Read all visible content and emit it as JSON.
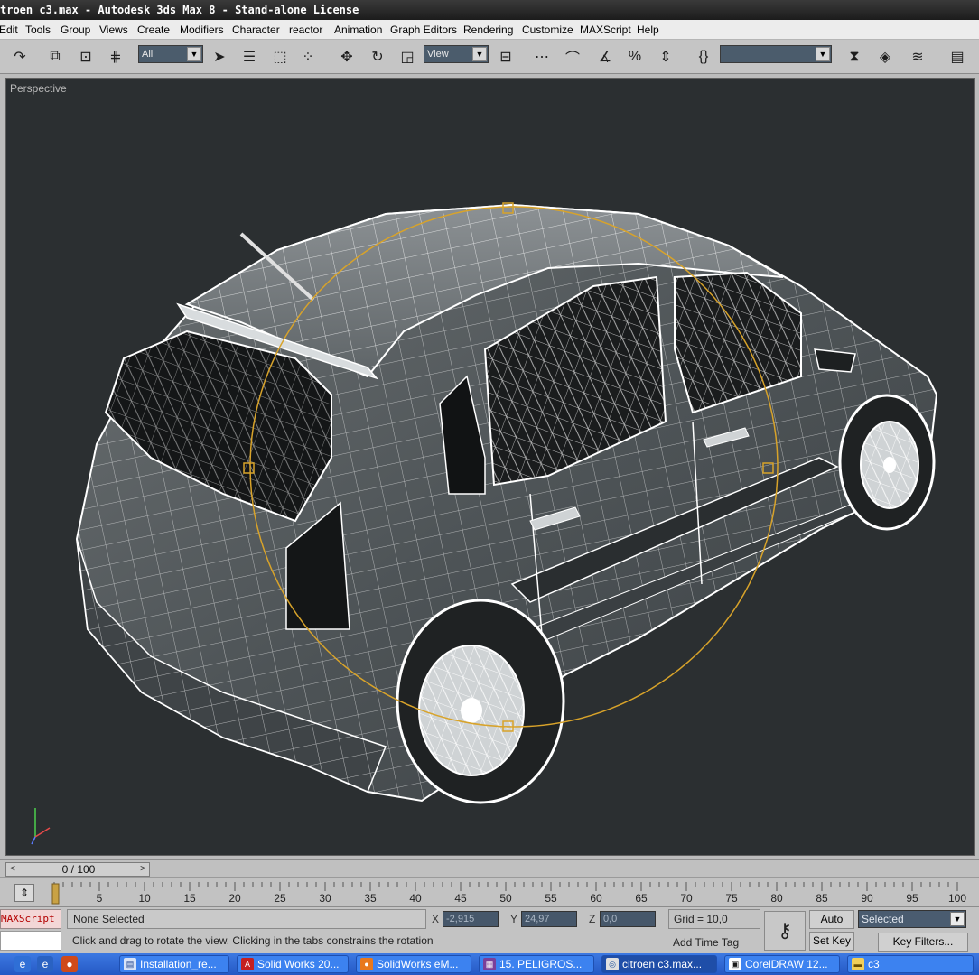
{
  "window": {
    "title": "troen c3.max - Autodesk 3ds Max 8  - Stand-alone License"
  },
  "menu": [
    "Edit",
    "Tools",
    "Group",
    "Views",
    "Create",
    "Modifiers",
    "Character",
    "reactor",
    "Animation",
    "Graph Editors",
    "Rendering",
    "Customize",
    "MAXScript",
    "Help"
  ],
  "toolbar": {
    "selection_filter": "All",
    "reference_coord": "View",
    "named_selection": "",
    "icons": [
      "undo-icon",
      "link-icon",
      "unlink-icon",
      "bind-spacewarp-icon",
      "select-object-icon",
      "select-by-name-icon",
      "rect-selection-icon",
      "window-crossing-icon",
      "move-icon",
      "rotate-icon",
      "scale-icon",
      "pivot-icon",
      "spinner-snap-icon",
      "snap-3d-icon",
      "angle-snap-icon",
      "percent-snap-icon",
      "spinner-snap-toggle-icon",
      "named-selection-braces-icon",
      "mirror-icon",
      "align-icon",
      "layer-manager-icon",
      "curve-editor-icon"
    ]
  },
  "viewport": {
    "label": "Perspective",
    "background": "#2b2f31",
    "wire_color": "#ffffff",
    "gizmo_color": "#d8a32a"
  },
  "timeslider": {
    "label": "0 / 100"
  },
  "trackbar": {
    "ticks": [
      "5",
      "10",
      "15",
      "20",
      "25",
      "30",
      "35",
      "40",
      "45",
      "50",
      "55",
      "60",
      "65",
      "70",
      "75",
      "80",
      "85",
      "90",
      "95",
      "100"
    ]
  },
  "status": {
    "maxscript_label": "MAXScript",
    "selection": "None Selected",
    "prompt": "Click and drag to rotate the view.  Clicking in the tabs constrains the rotation",
    "x_label": "X",
    "x_value": "-2,915",
    "y_label": "Y",
    "y_value": "24,97",
    "z_label": "Z",
    "z_value": "0,0",
    "grid": "Grid = 10,0",
    "add_time_tag": "Add Time Tag",
    "auto_key": "Auto Key",
    "set_key": "Set Key",
    "key_mode": "Selected",
    "key_filters": "Key Filters..."
  },
  "taskbar": {
    "quick_launch": [
      "ie-icon",
      "ie-alt-icon",
      "browser-icon"
    ],
    "tasks": [
      {
        "label": "Installation_re...",
        "icon": "document-icon"
      },
      {
        "label": "Solid Works 20...",
        "icon": "pdf-icon"
      },
      {
        "label": "SolidWorks eM...",
        "icon": "firefox-icon"
      },
      {
        "label": "15. PELIGROS...",
        "icon": "winrar-icon"
      },
      {
        "label": "citroen c3.max...",
        "icon": "3dsmax-icon"
      },
      {
        "label": "CorelDRAW 12...",
        "icon": "coreldraw-icon"
      },
      {
        "label": "c3",
        "icon": "folder-icon"
      }
    ]
  }
}
